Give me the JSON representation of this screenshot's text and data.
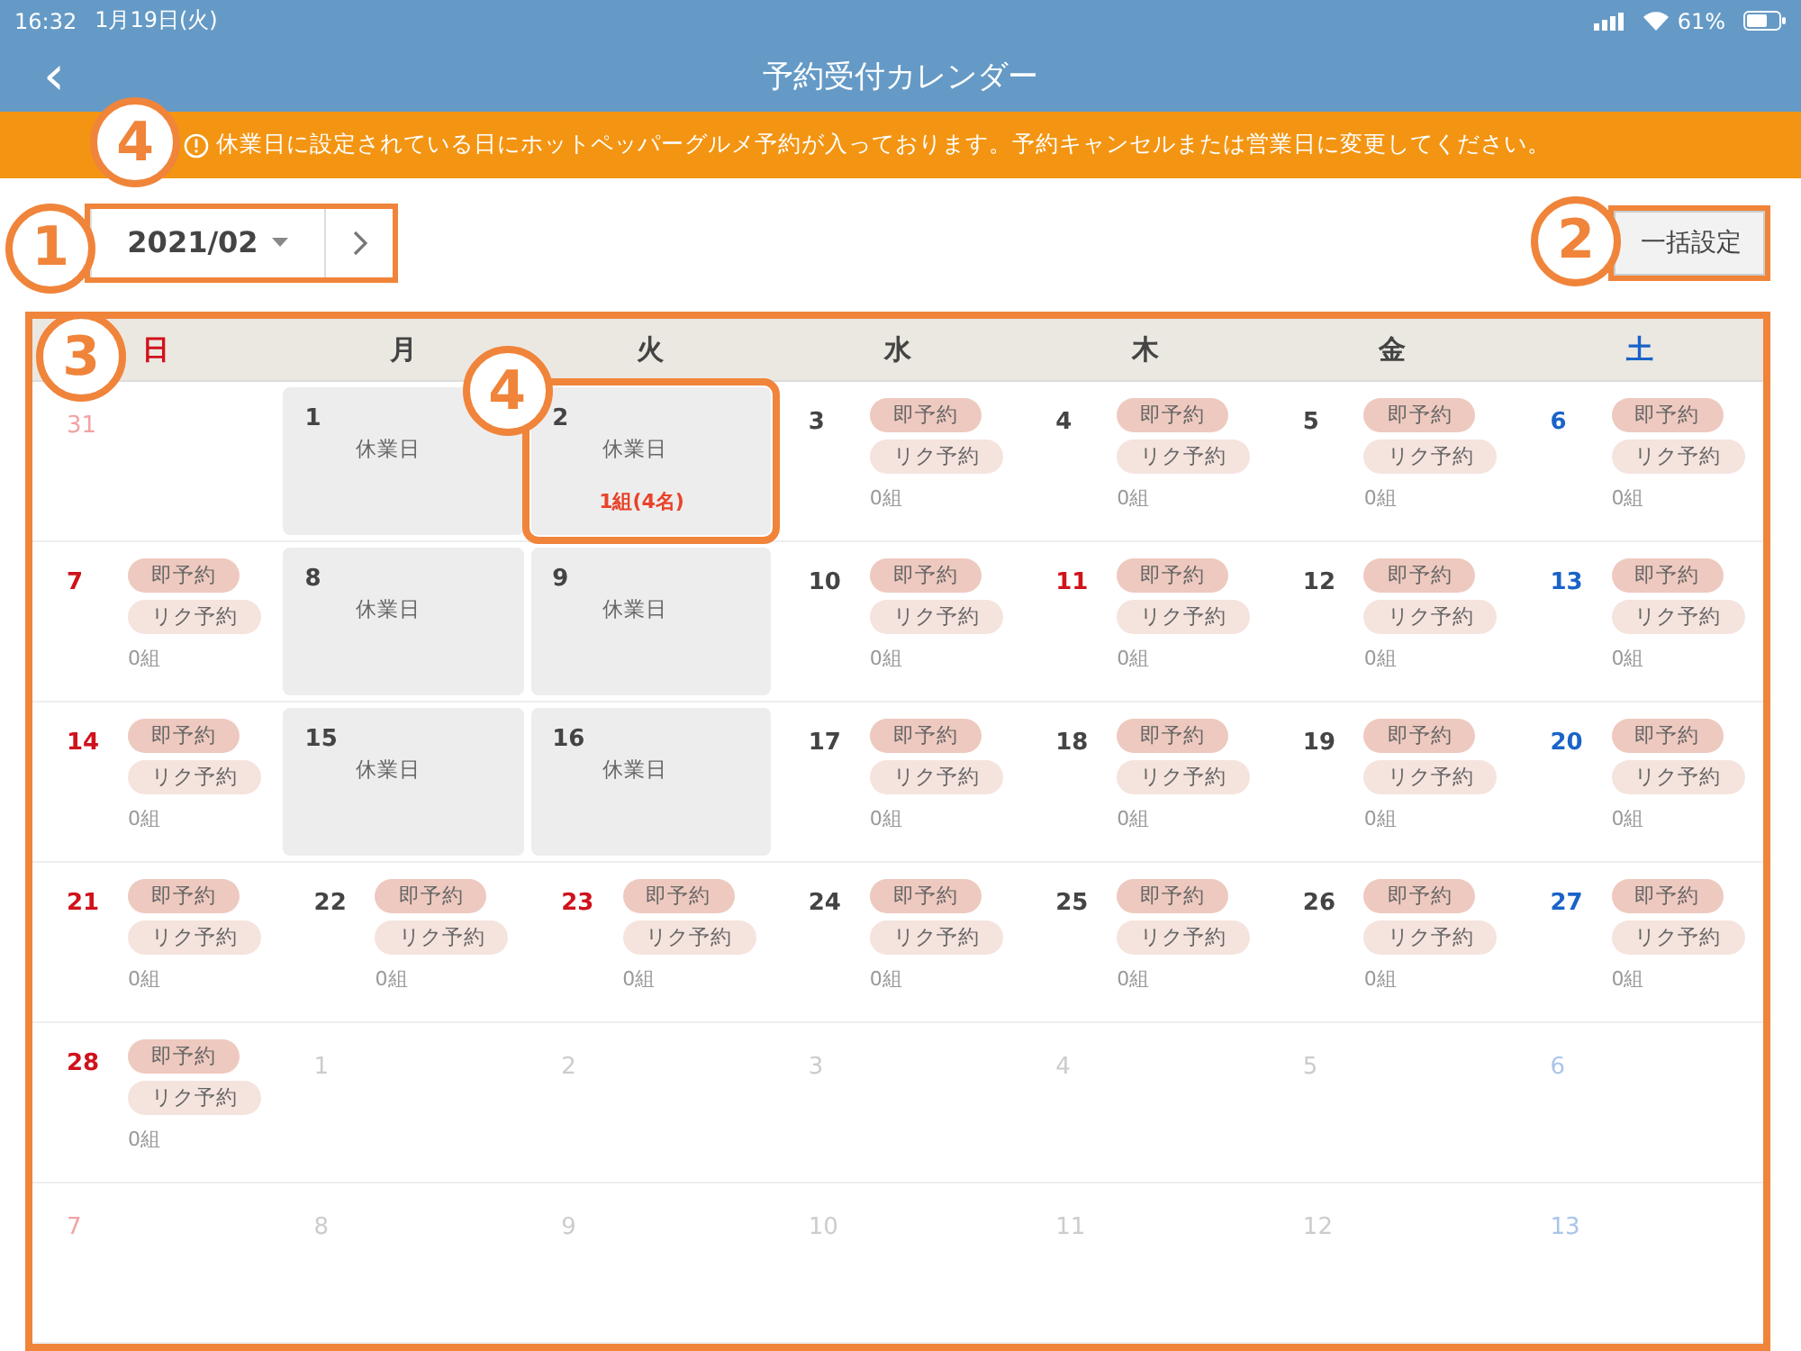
{
  "status_bar": {
    "time": "16:32",
    "date": "1月19日(火)",
    "battery": "61%"
  },
  "nav": {
    "title": "予約受付カレンダー",
    "back": "‹"
  },
  "banner": {
    "text": "休業日に設定されている日にホットペッパーグルメ予約が入っております。予約キャンセルまたは営業日に変更してください。",
    "callout": "4"
  },
  "month_picker": {
    "value": "2021/02",
    "callout": "1"
  },
  "bulk_button": {
    "label": "一括設定",
    "callout": "2"
  },
  "calendar": {
    "callout": "3",
    "weekdays": [
      "日",
      "月",
      "火",
      "水",
      "木",
      "金",
      "土"
    ],
    "weeks": [
      [
        {
          "date": "31",
          "kind": "outside"
        },
        {
          "date": "1",
          "kind": "closed",
          "label": "休業日"
        },
        {
          "date": "2",
          "kind": "closed",
          "label": "休業日",
          "bookings": "1組(4名)",
          "callout": "4"
        },
        {
          "date": "3",
          "kind": "open",
          "pills": [
            "即予約",
            "リク予約"
          ],
          "count": "0組"
        },
        {
          "date": "4",
          "kind": "open",
          "pills": [
            "即予約",
            "リク予約"
          ],
          "count": "0組"
        },
        {
          "date": "5",
          "kind": "open",
          "pills": [
            "即予約",
            "リク予約"
          ],
          "count": "0組"
        },
        {
          "date": "6",
          "kind": "open",
          "pills": [
            "即予約",
            "リク予約"
          ],
          "count": "0組"
        }
      ],
      [
        {
          "date": "7",
          "kind": "open",
          "pills": [
            "即予約",
            "リク予約"
          ],
          "count": "0組"
        },
        {
          "date": "8",
          "kind": "closed",
          "label": "休業日"
        },
        {
          "date": "9",
          "kind": "closed",
          "label": "休業日"
        },
        {
          "date": "10",
          "kind": "open",
          "pills": [
            "即予約",
            "リク予約"
          ],
          "count": "0組"
        },
        {
          "date": "11",
          "kind": "open",
          "holiday": true,
          "pills": [
            "即予約",
            "リク予約"
          ],
          "count": "0組"
        },
        {
          "date": "12",
          "kind": "open",
          "pills": [
            "即予約",
            "リク予約"
          ],
          "count": "0組"
        },
        {
          "date": "13",
          "kind": "open",
          "pills": [
            "即予約",
            "リク予約"
          ],
          "count": "0組"
        }
      ],
      [
        {
          "date": "14",
          "kind": "open",
          "pills": [
            "即予約",
            "リク予約"
          ],
          "count": "0組"
        },
        {
          "date": "15",
          "kind": "closed",
          "label": "休業日"
        },
        {
          "date": "16",
          "kind": "closed",
          "label": "休業日"
        },
        {
          "date": "17",
          "kind": "open",
          "pills": [
            "即予約",
            "リク予約"
          ],
          "count": "0組"
        },
        {
          "date": "18",
          "kind": "open",
          "pills": [
            "即予約",
            "リク予約"
          ],
          "count": "0組"
        },
        {
          "date": "19",
          "kind": "open",
          "pills": [
            "即予約",
            "リク予約"
          ],
          "count": "0組"
        },
        {
          "date": "20",
          "kind": "open",
          "pills": [
            "即予約",
            "リク予約"
          ],
          "count": "0組"
        }
      ],
      [
        {
          "date": "21",
          "kind": "open",
          "pills": [
            "即予約",
            "リク予約"
          ],
          "count": "0組"
        },
        {
          "date": "22",
          "kind": "open",
          "pills": [
            "即予約",
            "リク予約"
          ],
          "count": "0組"
        },
        {
          "date": "23",
          "kind": "open",
          "holiday": true,
          "pills": [
            "即予約",
            "リク予約"
          ],
          "count": "0組"
        },
        {
          "date": "24",
          "kind": "open",
          "pills": [
            "即予約",
            "リク予約"
          ],
          "count": "0組"
        },
        {
          "date": "25",
          "kind": "open",
          "pills": [
            "即予約",
            "リク予約"
          ],
          "count": "0組"
        },
        {
          "date": "26",
          "kind": "open",
          "pills": [
            "即予約",
            "リク予約"
          ],
          "count": "0組"
        },
        {
          "date": "27",
          "kind": "open",
          "pills": [
            "即予約",
            "リク予約"
          ],
          "count": "0組"
        }
      ],
      [
        {
          "date": "28",
          "kind": "open",
          "pills": [
            "即予約",
            "リク予約"
          ],
          "count": "0組"
        },
        {
          "date": "1",
          "kind": "outside"
        },
        {
          "date": "2",
          "kind": "outside"
        },
        {
          "date": "3",
          "kind": "outside"
        },
        {
          "date": "4",
          "kind": "outside"
        },
        {
          "date": "5",
          "kind": "outside"
        },
        {
          "date": "6",
          "kind": "outside"
        }
      ],
      [
        {
          "date": "7",
          "kind": "outside"
        },
        {
          "date": "8",
          "kind": "outside"
        },
        {
          "date": "9",
          "kind": "outside"
        },
        {
          "date": "10",
          "kind": "outside"
        },
        {
          "date": "11",
          "kind": "outside"
        },
        {
          "date": "12",
          "kind": "outside"
        },
        {
          "date": "13",
          "kind": "outside"
        }
      ]
    ]
  }
}
